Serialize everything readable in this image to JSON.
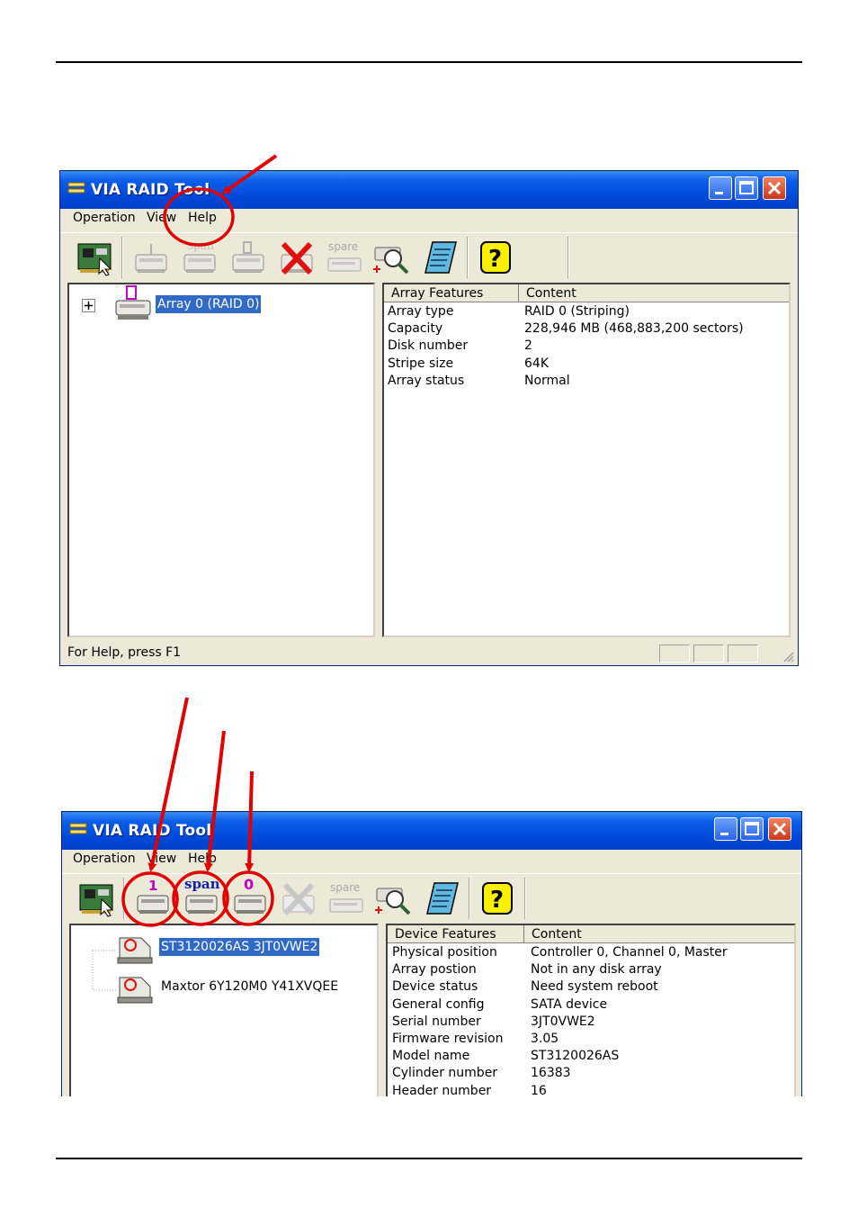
{
  "window1": {
    "title": "VIA RAID Tool",
    "menu": [
      "Operation",
      "View",
      "Help"
    ],
    "tree": {
      "label": "Array 0 (RAID 0)"
    },
    "list": {
      "headers": [
        "Array Features",
        "Content"
      ],
      "rows": [
        [
          "Array type",
          "RAID 0 (Striping)"
        ],
        [
          "Capacity",
          "228,946 MB (468,883,200 sectors)"
        ],
        [
          "Disk number",
          "2"
        ],
        [
          "Stripe size",
          "64K"
        ],
        [
          "Array status",
          "Normal"
        ]
      ]
    },
    "status": "For Help, press F1"
  },
  "window2": {
    "title": "VIA RAID Tool",
    "menu": [
      "Operation",
      "View",
      "Help"
    ],
    "tree": [
      "ST3120026AS 3JT0VWE2",
      "Maxtor 6Y120M0 Y41XVQEE"
    ],
    "list": {
      "headers": [
        "Device Features",
        "Content"
      ],
      "rows": [
        [
          "Physical position",
          "Controller 0, Channel 0, Master"
        ],
        [
          "Array postion",
          "Not in any disk array"
        ],
        [
          "Device status",
          "Need system reboot"
        ],
        [
          "General config",
          "SATA device"
        ],
        [
          "Serial number",
          "3JT0VWE2"
        ],
        [
          "Firmware revision",
          "3.05"
        ],
        [
          "Model name",
          "ST3120026AS"
        ],
        [
          "Cylinder number",
          "16383"
        ],
        [
          "Header number",
          "16"
        ]
      ]
    }
  },
  "toolbar": {
    "spare_label": "spare",
    "span_label": "span",
    "raid1_label": "1",
    "raid0_label": "0",
    "help_label": "?"
  },
  "icons": [
    "raid-controller-icon",
    "create-raid1-icon",
    "create-span-icon",
    "create-raid0-icon",
    "delete-array-icon",
    "add-spare-icon",
    "rescan-icon",
    "event-log-icon",
    "help-icon"
  ],
  "colors": {
    "title_bar": "#0048d8",
    "selection": "#316ac5",
    "annotation": "#e00000",
    "spare_gray": "#a8a8a8"
  }
}
